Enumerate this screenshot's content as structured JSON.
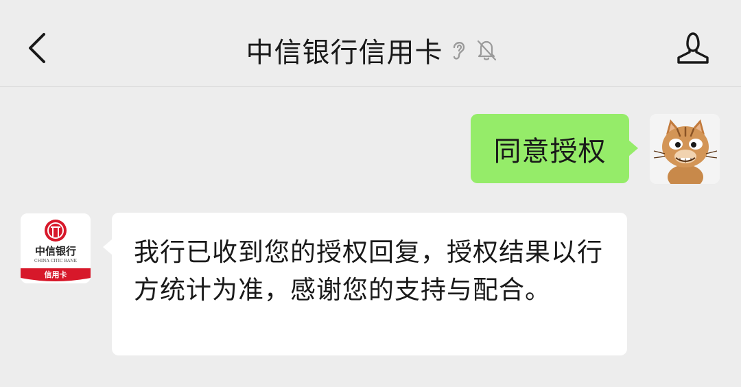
{
  "header": {
    "back_icon": "chevron-left-icon",
    "title": "中信银行信用卡",
    "status_icons": [
      "ear-icon",
      "bell-muted-icon"
    ],
    "profile_icon": "person-icon"
  },
  "messages": [
    {
      "direction": "outgoing",
      "text": "同意授权",
      "avatar": "cat-avatar",
      "bubble_color": "#95ec69"
    },
    {
      "direction": "incoming",
      "text": " 我行已收到您的授权回复，授权结果以行方统计为准，感谢您的支持与配合。",
      "avatar": "bank-logo-avatar",
      "bubble_color": "#ffffff"
    }
  ],
  "bank_logo": {
    "name": "中信银行",
    "english": "CHINA CITIC BANK",
    "tag": "信用卡",
    "brand_color": "#d7182a"
  },
  "colors": {
    "background": "#ededed",
    "outgoing_bubble": "#95ec69",
    "incoming_bubble": "#ffffff"
  }
}
